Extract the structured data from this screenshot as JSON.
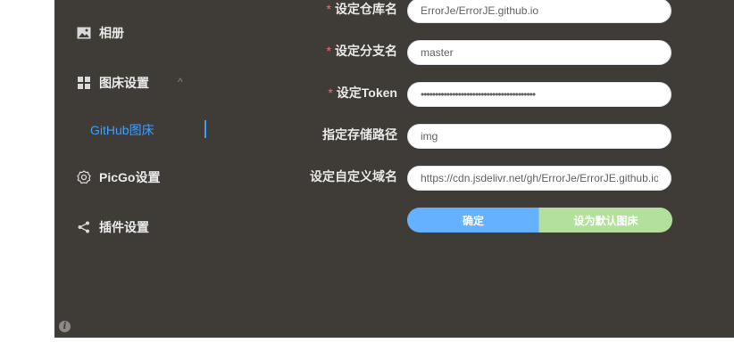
{
  "sidebar": {
    "gallery": {
      "label": "相册",
      "icon": "image-icon"
    },
    "picbed": {
      "label": "图床设置",
      "icon": "grid-icon",
      "caret": "^"
    },
    "github": {
      "label": "GitHub图床"
    },
    "picgo": {
      "label": "PicGo设置",
      "icon": "gear-icon"
    },
    "plugins": {
      "label": "插件设置",
      "icon": "share-icon"
    }
  },
  "form": {
    "repo": {
      "label": "设定仓库名",
      "required": "*",
      "value": "ErrorJe/ErrorJE.github.io"
    },
    "branch": {
      "label": "设定分支名",
      "required": "*",
      "value": "master"
    },
    "token": {
      "label": "设定Token",
      "required": "*",
      "value": "••••••••••••••••••••••••••••••••••••••••"
    },
    "path": {
      "label": "指定存储路径",
      "value": "img"
    },
    "domain": {
      "label": "设定自定义域名",
      "value": "https://cdn.jsdelivr.net/gh/ErrorJe/ErrorJE.github.io"
    }
  },
  "buttons": {
    "confirm": "确定",
    "set_default": "设为默认图床"
  },
  "info_icon": {
    "glyph": "i"
  },
  "colors": {
    "background": "#3f3b37",
    "accent": "#409eff",
    "confirm": "#66b1ff",
    "default": "#b3e19d",
    "required": "#f56c6c"
  }
}
